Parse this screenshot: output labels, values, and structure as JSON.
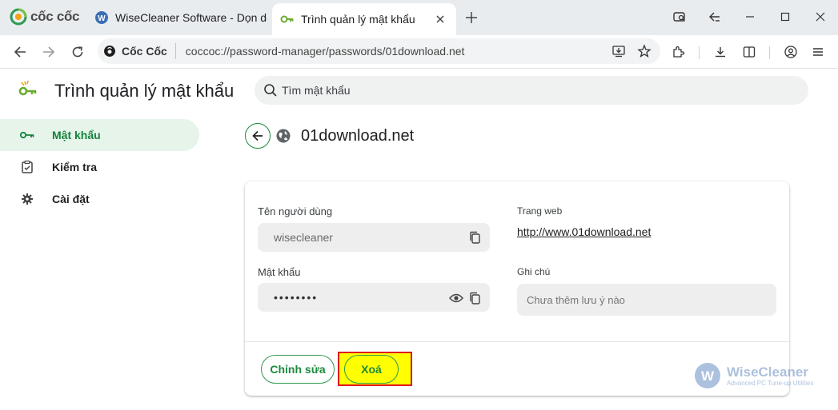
{
  "browser": {
    "brand": "cốc cốc",
    "tabs": [
      {
        "title": "WiseCleaner Software - Dọn dẹp",
        "active": false
      },
      {
        "title": "Trình quản lý mật khẩu",
        "active": true
      }
    ],
    "omnibox_brand": "Cốc Cốc",
    "url": "coccoc://password-manager/passwords/01download.net"
  },
  "page": {
    "title": "Trình quản lý mật khẩu",
    "search_placeholder": "Tìm mật khẩu"
  },
  "sidebar": {
    "items": [
      {
        "label": "Mật khẩu",
        "icon": "key-icon",
        "active": true
      },
      {
        "label": "Kiểm tra",
        "icon": "checkup-icon",
        "active": false
      },
      {
        "label": "Cài đặt",
        "icon": "gear-icon",
        "active": false
      }
    ]
  },
  "detail": {
    "site": "01download.net",
    "username_label": "Tên người dùng",
    "username": "wisecleaner",
    "password_label": "Mật khẩu",
    "password_masked": "••••••••",
    "website_label": "Trang web",
    "website": "http://www.01download.net",
    "note_label": "Ghi chú",
    "note_placeholder": "Chưa thêm lưu ý nào",
    "edit_label": "Chỉnh sửa",
    "delete_label": "Xoá"
  },
  "watermark": {
    "title": "WiseCleaner",
    "subtitle": "Advanced PC Tune-up Utilities"
  },
  "colors": {
    "accent": "#1a8a3d",
    "highlight": "#ffff00",
    "highlight_border": "#e0191b"
  }
}
